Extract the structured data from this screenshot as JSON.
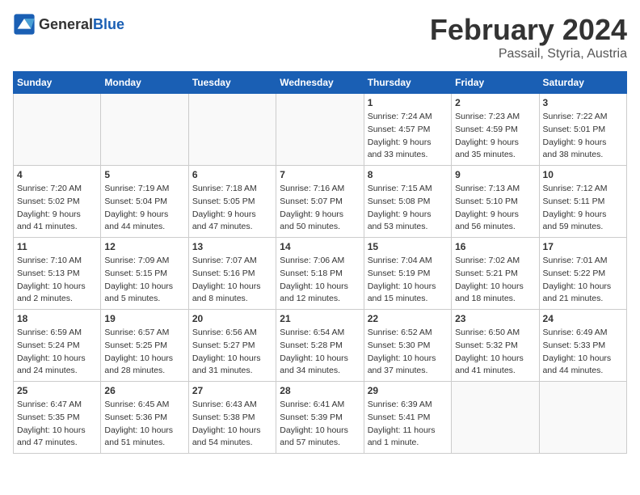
{
  "header": {
    "logo_general": "General",
    "logo_blue": "Blue",
    "title": "February 2024",
    "location": "Passail, Styria, Austria"
  },
  "weekdays": [
    "Sunday",
    "Monday",
    "Tuesday",
    "Wednesday",
    "Thursday",
    "Friday",
    "Saturday"
  ],
  "weeks": [
    [
      {
        "day": "",
        "info": ""
      },
      {
        "day": "",
        "info": ""
      },
      {
        "day": "",
        "info": ""
      },
      {
        "day": "",
        "info": ""
      },
      {
        "day": "1",
        "info": "Sunrise: 7:24 AM\nSunset: 4:57 PM\nDaylight: 9 hours\nand 33 minutes."
      },
      {
        "day": "2",
        "info": "Sunrise: 7:23 AM\nSunset: 4:59 PM\nDaylight: 9 hours\nand 35 minutes."
      },
      {
        "day": "3",
        "info": "Sunrise: 7:22 AM\nSunset: 5:01 PM\nDaylight: 9 hours\nand 38 minutes."
      }
    ],
    [
      {
        "day": "4",
        "info": "Sunrise: 7:20 AM\nSunset: 5:02 PM\nDaylight: 9 hours\nand 41 minutes."
      },
      {
        "day": "5",
        "info": "Sunrise: 7:19 AM\nSunset: 5:04 PM\nDaylight: 9 hours\nand 44 minutes."
      },
      {
        "day": "6",
        "info": "Sunrise: 7:18 AM\nSunset: 5:05 PM\nDaylight: 9 hours\nand 47 minutes."
      },
      {
        "day": "7",
        "info": "Sunrise: 7:16 AM\nSunset: 5:07 PM\nDaylight: 9 hours\nand 50 minutes."
      },
      {
        "day": "8",
        "info": "Sunrise: 7:15 AM\nSunset: 5:08 PM\nDaylight: 9 hours\nand 53 minutes."
      },
      {
        "day": "9",
        "info": "Sunrise: 7:13 AM\nSunset: 5:10 PM\nDaylight: 9 hours\nand 56 minutes."
      },
      {
        "day": "10",
        "info": "Sunrise: 7:12 AM\nSunset: 5:11 PM\nDaylight: 9 hours\nand 59 minutes."
      }
    ],
    [
      {
        "day": "11",
        "info": "Sunrise: 7:10 AM\nSunset: 5:13 PM\nDaylight: 10 hours\nand 2 minutes."
      },
      {
        "day": "12",
        "info": "Sunrise: 7:09 AM\nSunset: 5:15 PM\nDaylight: 10 hours\nand 5 minutes."
      },
      {
        "day": "13",
        "info": "Sunrise: 7:07 AM\nSunset: 5:16 PM\nDaylight: 10 hours\nand 8 minutes."
      },
      {
        "day": "14",
        "info": "Sunrise: 7:06 AM\nSunset: 5:18 PM\nDaylight: 10 hours\nand 12 minutes."
      },
      {
        "day": "15",
        "info": "Sunrise: 7:04 AM\nSunset: 5:19 PM\nDaylight: 10 hours\nand 15 minutes."
      },
      {
        "day": "16",
        "info": "Sunrise: 7:02 AM\nSunset: 5:21 PM\nDaylight: 10 hours\nand 18 minutes."
      },
      {
        "day": "17",
        "info": "Sunrise: 7:01 AM\nSunset: 5:22 PM\nDaylight: 10 hours\nand 21 minutes."
      }
    ],
    [
      {
        "day": "18",
        "info": "Sunrise: 6:59 AM\nSunset: 5:24 PM\nDaylight: 10 hours\nand 24 minutes."
      },
      {
        "day": "19",
        "info": "Sunrise: 6:57 AM\nSunset: 5:25 PM\nDaylight: 10 hours\nand 28 minutes."
      },
      {
        "day": "20",
        "info": "Sunrise: 6:56 AM\nSunset: 5:27 PM\nDaylight: 10 hours\nand 31 minutes."
      },
      {
        "day": "21",
        "info": "Sunrise: 6:54 AM\nSunset: 5:28 PM\nDaylight: 10 hours\nand 34 minutes."
      },
      {
        "day": "22",
        "info": "Sunrise: 6:52 AM\nSunset: 5:30 PM\nDaylight: 10 hours\nand 37 minutes."
      },
      {
        "day": "23",
        "info": "Sunrise: 6:50 AM\nSunset: 5:32 PM\nDaylight: 10 hours\nand 41 minutes."
      },
      {
        "day": "24",
        "info": "Sunrise: 6:49 AM\nSunset: 5:33 PM\nDaylight: 10 hours\nand 44 minutes."
      }
    ],
    [
      {
        "day": "25",
        "info": "Sunrise: 6:47 AM\nSunset: 5:35 PM\nDaylight: 10 hours\nand 47 minutes."
      },
      {
        "day": "26",
        "info": "Sunrise: 6:45 AM\nSunset: 5:36 PM\nDaylight: 10 hours\nand 51 minutes."
      },
      {
        "day": "27",
        "info": "Sunrise: 6:43 AM\nSunset: 5:38 PM\nDaylight: 10 hours\nand 54 minutes."
      },
      {
        "day": "28",
        "info": "Sunrise: 6:41 AM\nSunset: 5:39 PM\nDaylight: 10 hours\nand 57 minutes."
      },
      {
        "day": "29",
        "info": "Sunrise: 6:39 AM\nSunset: 5:41 PM\nDaylight: 11 hours\nand 1 minute."
      },
      {
        "day": "",
        "info": ""
      },
      {
        "day": "",
        "info": ""
      }
    ]
  ]
}
